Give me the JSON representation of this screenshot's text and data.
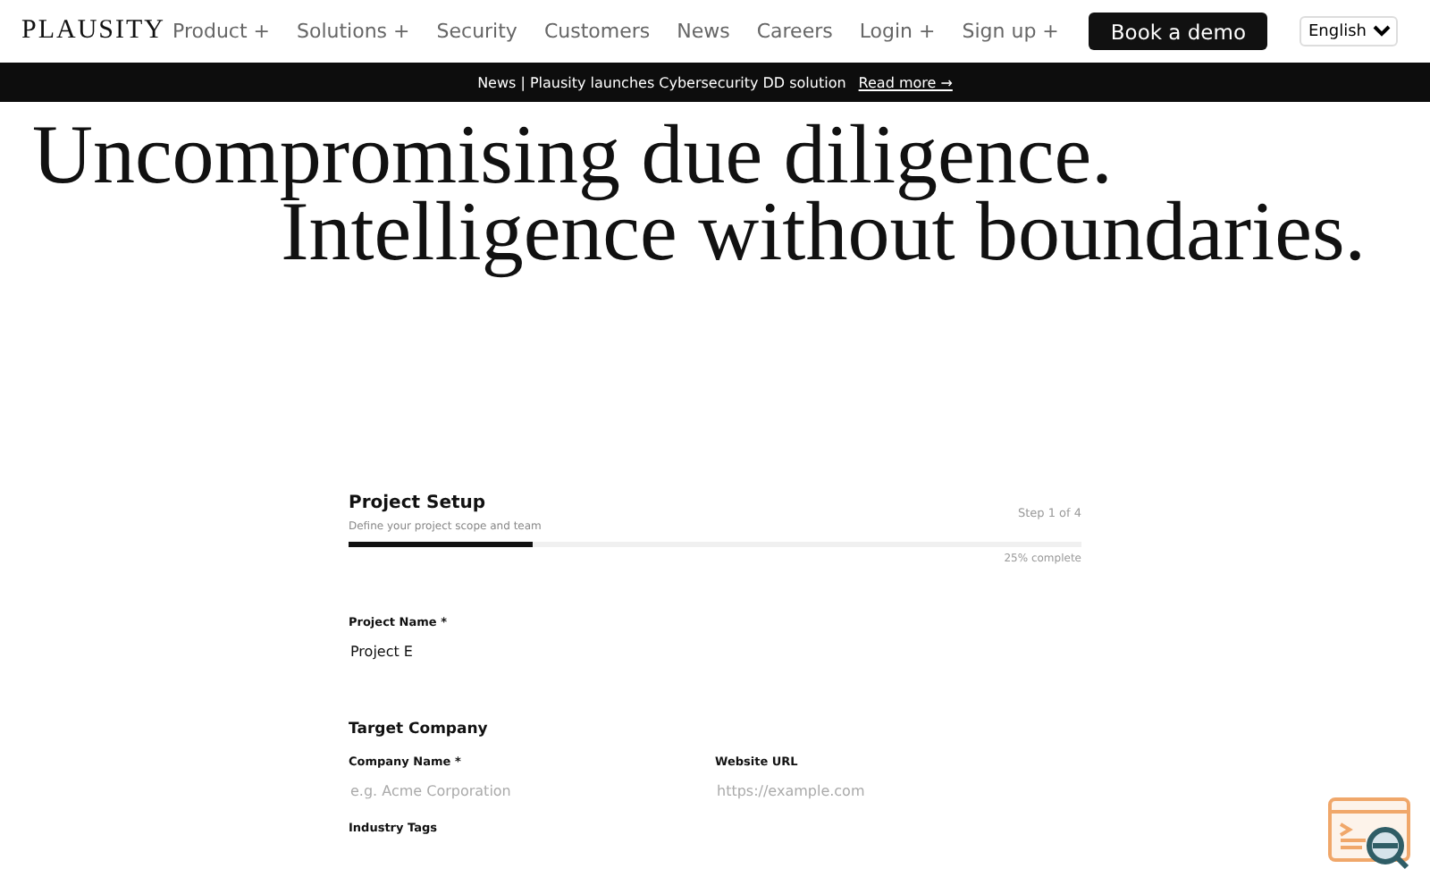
{
  "nav": {
    "logo": "PLAUSITY",
    "items": [
      {
        "label": "Product +"
      },
      {
        "label": "Solutions +"
      },
      {
        "label": "Security"
      },
      {
        "label": "Customers"
      },
      {
        "label": "News"
      },
      {
        "label": "Careers"
      },
      {
        "label": "Login +"
      },
      {
        "label": "Sign up +"
      }
    ],
    "cta": "Book a demo",
    "language": "English"
  },
  "banner": {
    "text": "News | Plausity launches Cybersecurity DD solution",
    "link": "Read more →"
  },
  "hero": {
    "lines": [
      "Uncompromising due diligence.",
      "Intelligence without boundaries."
    ]
  },
  "form": {
    "title": "Project Setup",
    "subtitle": "Define your project scope and team",
    "step": "Step 1 of 4",
    "progress": {
      "level": 0.25,
      "reading": "25% complete"
    },
    "project_name": {
      "label": "Project Name *",
      "value": "Project E"
    },
    "section": "Target Company",
    "fields": [
      {
        "label": "Company Name *",
        "placeholder": "e.g. Acme Corporation"
      },
      {
        "label": "Website URL",
        "placeholder": "https://example.com"
      }
    ],
    "tags_label": "Industry Tags"
  }
}
